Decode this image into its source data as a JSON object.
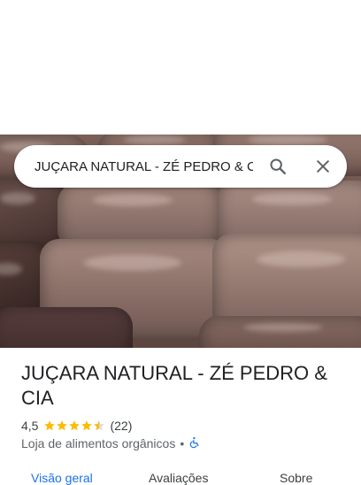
{
  "search": {
    "value": "JUÇARA NATURAL - ZÉ PEDRO & CIA",
    "search_icon": "search-icon",
    "close_icon": "close-icon"
  },
  "place": {
    "name": "JUÇARA NATURAL - ZÉ PEDRO & CIA",
    "rating": "4,5",
    "rating_value": 4.5,
    "review_count": "(22)",
    "category": "Loja de alimentos orgânicos",
    "separator": "•",
    "accessibility_icon": "wheelchair-icon"
  },
  "tabs": [
    {
      "label": "Visão geral",
      "active": true
    },
    {
      "label": "Avaliações",
      "active": false
    },
    {
      "label": "Sobre",
      "active": false
    }
  ],
  "colors": {
    "accent": "#1a73e8",
    "star": "#fbbc04",
    "text": "#202124",
    "secondary": "#5f6368"
  }
}
